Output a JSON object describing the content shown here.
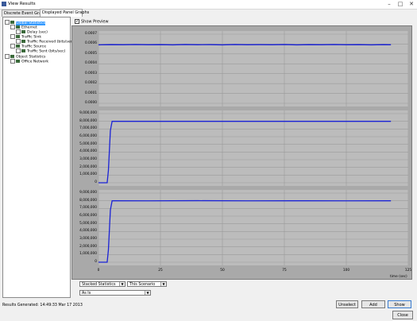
{
  "window": {
    "title": "View Results",
    "controls": {
      "minimize": "–",
      "maximize": "□",
      "close": "✕"
    }
  },
  "tabs": [
    {
      "label": "Discrete Event Graphs"
    },
    {
      "label": "Displayed Panel Graphs",
      "active": true
    }
  ],
  "tree": [
    {
      "label": "Global Statistics",
      "level": 0,
      "selected": true
    },
    {
      "label": "Ethernet",
      "level": 1
    },
    {
      "label": "Delay (sec)",
      "level": 2
    },
    {
      "label": "Traffic Sink",
      "level": 1
    },
    {
      "label": "Traffic Received (bits/sec)",
      "level": 2
    },
    {
      "label": "Traffic Source",
      "level": 1
    },
    {
      "label": "Traffic Sent (bits/sec)",
      "level": 2
    },
    {
      "label": "Object Statistics",
      "level": 0
    },
    {
      "label": "Office Network",
      "level": 1
    }
  ],
  "preview": {
    "label": "Show Preview",
    "checked": true
  },
  "chart_data": [
    {
      "type": "line",
      "yticks": [
        "0.0007",
        "0.0006",
        "0.0005",
        "0.0004",
        "0.0003",
        "0.0002",
        "0.0001",
        "0.0000"
      ],
      "ylim": [
        0,
        0.0007
      ],
      "xlim": [
        0,
        125
      ],
      "series": [
        {
          "x": [
            0,
            5,
            10,
            15,
            20,
            25,
            30,
            35,
            40,
            45,
            50,
            55,
            60,
            65,
            70,
            75,
            80,
            85,
            90,
            95,
            100,
            105,
            110,
            115,
            118
          ],
          "y": [
            0.000592,
            0.000594,
            0.000593,
            0.000595,
            0.000593,
            0.000594,
            0.000592,
            0.000595,
            0.000593,
            0.000594,
            0.000592,
            0.000595,
            0.000593,
            0.000594,
            0.000593,
            0.000595,
            0.000592,
            0.000594,
            0.000593,
            0.000595,
            0.000593,
            0.000594,
            0.000592,
            0.000594,
            0.000593
          ]
        }
      ]
    },
    {
      "type": "line",
      "yticks": [
        "9,000,000",
        "8,000,000",
        "7,000,000",
        "6,000,000",
        "5,000,000",
        "4,000,000",
        "3,000,000",
        "2,000,000",
        "1,000,000",
        "0"
      ],
      "ylim": [
        0,
        9000000
      ],
      "xlim": [
        0,
        125
      ],
      "series": [
        {
          "x": [
            0,
            3.5,
            4,
            4.8,
            5.5,
            118
          ],
          "y": [
            0,
            0,
            1600000,
            6800000,
            8000000,
            8000000
          ]
        }
      ]
    },
    {
      "type": "line",
      "yticks": [
        "9,000,000",
        "8,000,000",
        "7,000,000",
        "6,000,000",
        "5,000,000",
        "4,000,000",
        "3,000,000",
        "2,000,000",
        "1,000,000",
        "0"
      ],
      "ylim": [
        0,
        9000000
      ],
      "xlim": [
        0,
        125
      ],
      "series": [
        {
          "x": [
            0,
            3.5,
            4,
            4.8,
            5.5,
            20,
            40,
            60,
            80,
            100,
            118
          ],
          "y": [
            0,
            0,
            1600000,
            6800000,
            8000000,
            7990000,
            8010000,
            7990000,
            8000000,
            7995000,
            8000000
          ]
        }
      ]
    }
  ],
  "x_axis": {
    "ticks": [
      "0",
      "25",
      "50",
      "75",
      "100",
      "125"
    ],
    "label": "time (sec)"
  },
  "controls": {
    "stat_mode": "Stacked Statistics",
    "scenario": "This Scenario",
    "filter": "As Is"
  },
  "status": "Results Generated: 14:49:33 Mar 17 2013",
  "buttons": {
    "unselect": "Unselect",
    "add": "Add",
    "show": "Show",
    "close": "Close"
  }
}
